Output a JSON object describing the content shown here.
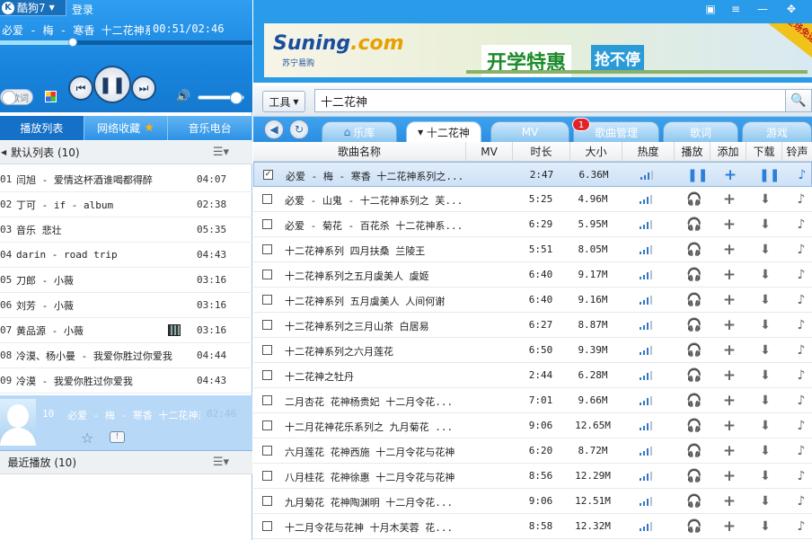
{
  "app": {
    "name": "酷狗7",
    "login": "登录",
    "logo_letter": "K"
  },
  "player": {
    "now_playing": "必爱 - 梅 - 寒香 十二花神系",
    "time": "00:51/02:46",
    "progress": 0.29,
    "volume": 0.84,
    "lyric_toggle": "歌词"
  },
  "left_tabs": [
    {
      "label": "播放列表",
      "active": true
    },
    {
      "label": "网络收藏",
      "active": false
    },
    {
      "label": "音乐电台",
      "active": false
    }
  ],
  "default_list": {
    "title": "默认列表 (10)"
  },
  "songs": [
    {
      "num": "01",
      "name": "闫旭 - 爱情这杯酒谁喝都得醉",
      "dur": "04:07"
    },
    {
      "num": "02",
      "name": "丁可 - if - album",
      "dur": "02:38"
    },
    {
      "num": "03",
      "name": "音乐 悲壮",
      "dur": "05:35"
    },
    {
      "num": "04",
      "name": "darin - road trip",
      "dur": "04:43"
    },
    {
      "num": "05",
      "name": "刀郎 - 小薇",
      "dur": "03:16"
    },
    {
      "num": "06",
      "name": "刘芳 - 小薇",
      "dur": "03:16"
    },
    {
      "num": "07",
      "name": "黄品源 - 小薇",
      "dur": "03:16",
      "mv": true
    },
    {
      "num": "08",
      "name": "冷漠、杨小曼 - 我爱你胜过你爱我",
      "dur": "04:44"
    },
    {
      "num": "09",
      "name": "冷漠 - 我爱你胜过你爱我",
      "dur": "04:43"
    }
  ],
  "current": {
    "num": "10",
    "name": "必爱 - 梅 - 寒香 十二花神系列之",
    "dur": "02:46"
  },
  "recent_list": {
    "title": "最近播放 (10)"
  },
  "ad": {
    "brand": "Suning",
    "brand_dot": ".com",
    "brand_sub": "苏宁易购",
    "slogan_a": "开学特惠",
    "slogan_b": "抢不停",
    "corner": "全场免运"
  },
  "toolbar": {
    "tools": "工具",
    "search_value": "十二花神"
  },
  "tabs": {
    "music_lib": "乐库",
    "current": "十二花神",
    "mv": "MV",
    "manage": "歌曲管理",
    "lyrics": "歌词",
    "games": "游戏",
    "badge": "1"
  },
  "columns": {
    "name": "歌曲名称",
    "mv": "MV",
    "duration": "时长",
    "size": "大小",
    "heat": "热度",
    "play": "播放",
    "add": "添加",
    "download": "下载",
    "ring": "铃声"
  },
  "results": [
    {
      "name": "必爱 - 梅 - 寒香 十二花神系列之...",
      "dur": "2:47",
      "size": "6.36M",
      "heat": 3,
      "checked": true,
      "selected": true
    },
    {
      "name": "必爱 - 山鬼 - 十二花神系列之 芙...",
      "dur": "5:25",
      "size": "4.96M",
      "heat": 3
    },
    {
      "name": "必爱 - 菊花 - 百花杀 十二花神系...",
      "dur": "6:29",
      "size": "5.95M",
      "heat": 3
    },
    {
      "name": "十二花神系列 四月扶桑 兰陵王",
      "dur": "5:51",
      "size": "8.05M",
      "heat": 3
    },
    {
      "name": "十二花神系列之五月虞美人 虞姬",
      "dur": "6:40",
      "size": "9.17M",
      "heat": 3
    },
    {
      "name": "十二花神系列 五月虞美人 人间何谢",
      "dur": "6:40",
      "size": "9.16M",
      "heat": 3
    },
    {
      "name": "十二花神系列之三月山茶 白居易",
      "dur": "6:27",
      "size": "8.87M",
      "heat": 3
    },
    {
      "name": "十二花神系列之六月莲花",
      "dur": "6:50",
      "size": "9.39M",
      "heat": 3
    },
    {
      "name": "十二花神之牡丹",
      "dur": "2:44",
      "size": "6.28M",
      "heat": 3
    },
    {
      "name": "二月杏花 花神杨贵妃 十二月令花...",
      "dur": "7:01",
      "size": "9.66M",
      "heat": 3
    },
    {
      "name": "十二月花神花乐系列之 九月菊花 ...",
      "dur": "9:06",
      "size": "12.65M",
      "heat": 3
    },
    {
      "name": "六月莲花 花神西施 十二月令花与花神",
      "dur": "6:20",
      "size": "8.72M",
      "heat": 3
    },
    {
      "name": "八月桂花 花神徐惠 十二月令花与花神",
      "dur": "8:56",
      "size": "12.29M",
      "heat": 3
    },
    {
      "name": "九月菊花 花神陶渊明 十二月令花...",
      "dur": "9:06",
      "size": "12.51M",
      "heat": 3
    },
    {
      "name": "十二月令花与花神 十月木芙蓉 花...",
      "dur": "8:58",
      "size": "12.32M",
      "heat": 3
    }
  ],
  "colors": {
    "accent": "#1a86df",
    "selected_row": "#cde1f6",
    "badge": "#e2242a"
  }
}
